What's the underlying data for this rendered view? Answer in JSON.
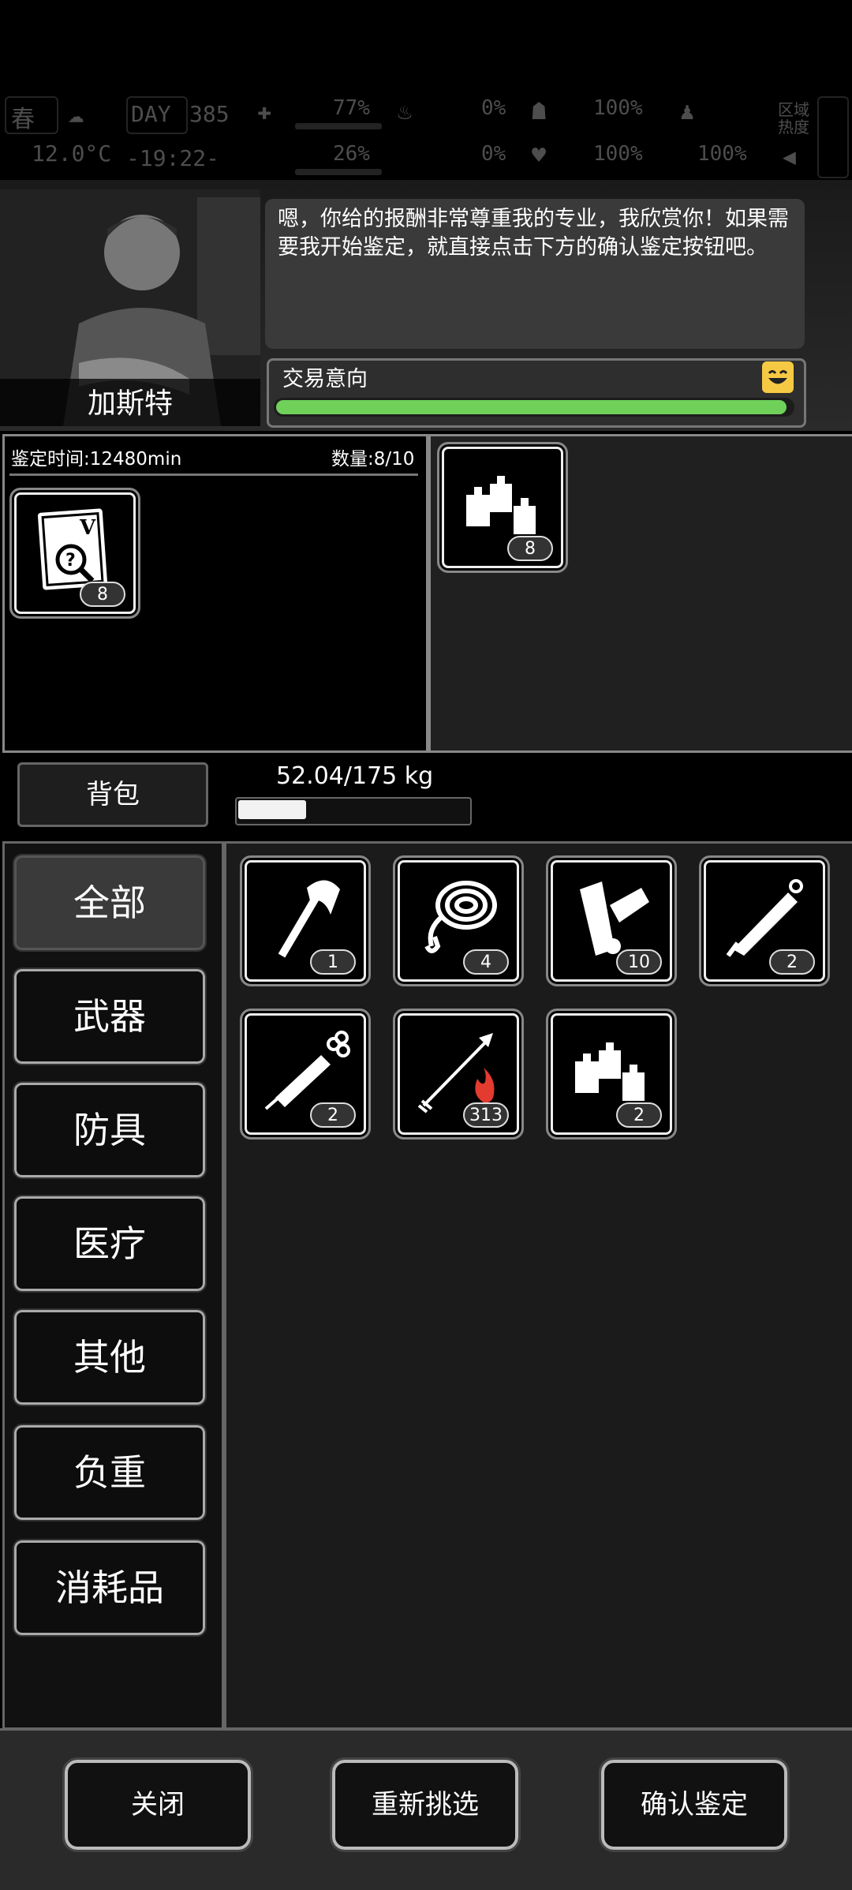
{
  "hud": {
    "season": "春",
    "day_label": "DAY",
    "day": "385",
    "temperature": "12.0°C",
    "time": "-19:22-",
    "stat1": "77%",
    "stat2": "26%",
    "stat3": "0%",
    "stat4": "0%",
    "stat5": "100%",
    "stat6": "100%",
    "stat7": "100%",
    "stat8": "100%",
    "zone_label": "区域热度"
  },
  "npc": {
    "name": "加斯特",
    "dialog": "嗯，你给的报酬非常尊重我的专业，我欣赏你！如果需要我开始鉴定，就直接点击下方的确认鉴定按钮吧。",
    "intent_label": "交易意向",
    "intent_level": 0.99
  },
  "appraisal": {
    "time_label": "鉴定时间:12480min",
    "quantity_label": "数量:8/10",
    "item": {
      "icon": "appraisal-document-icon",
      "count": "8"
    }
  },
  "offer": {
    "items": [
      {
        "icon": "bottles-icon",
        "count": "8"
      }
    ]
  },
  "backpack": {
    "tab_label": "背包",
    "weight_text": "52.04/175 kg",
    "weight_fraction": 0.297
  },
  "categories": [
    {
      "label": "全部",
      "active": true
    },
    {
      "label": "武器",
      "active": false
    },
    {
      "label": "防具",
      "active": false
    },
    {
      "label": "医疗",
      "active": false
    },
    {
      "label": "其他",
      "active": false
    },
    {
      "label": "负重",
      "active": false
    },
    {
      "label": "消耗品",
      "active": false
    }
  ],
  "inventory": [
    {
      "icon": "axe-icon",
      "count": "1"
    },
    {
      "icon": "rope-icon",
      "count": "4"
    },
    {
      "icon": "bandage-roll-icon",
      "count": "10"
    },
    {
      "icon": "knife-icon",
      "count": "2"
    },
    {
      "icon": "syringe-icon",
      "count": "2"
    },
    {
      "icon": "fire-arrow-icon",
      "count": "313"
    },
    {
      "icon": "bottles-icon",
      "count": "2"
    }
  ],
  "buttons": {
    "close": "关闭",
    "reselect": "重新挑选",
    "confirm": "确认鉴定"
  },
  "colors": {
    "intent_green": "#6fd15a",
    "emoji_yellow": "#f6c944",
    "fire_red": "#e33b2f"
  }
}
